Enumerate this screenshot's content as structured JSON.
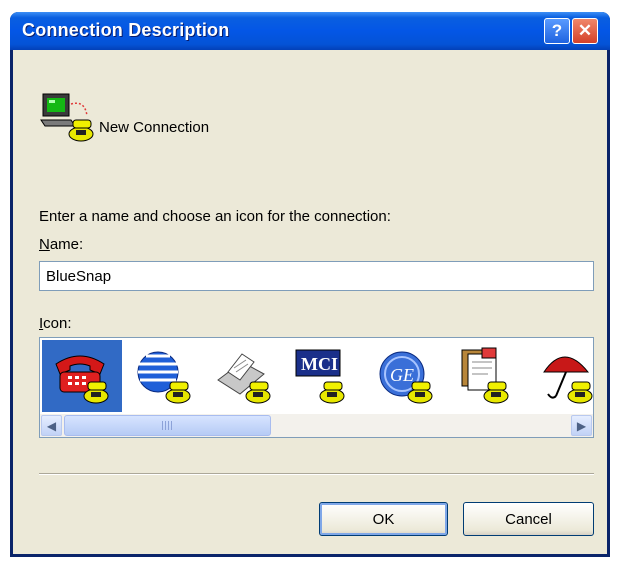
{
  "window": {
    "title": "Connection Description",
    "help_glyph": "?",
    "close_glyph": "✕"
  },
  "connection": {
    "name": "New Connection",
    "icon": "computer-phone-icon"
  },
  "prompt": "Enter a name and choose an icon for the connection:",
  "name_field": {
    "label_mnemonic": "N",
    "label_rest": "ame:",
    "value": "BlueSnap"
  },
  "icon_field": {
    "label_mnemonic": "I",
    "label_rest": "con:",
    "icons": [
      "red-phone-icon",
      "globe-phone-icon",
      "fax-phone-icon",
      "mci-phone-icon",
      "ge-phone-icon",
      "document-phone-icon",
      "umbrella-phone-icon"
    ],
    "selected_index": 0
  },
  "buttons": {
    "ok": "OK",
    "cancel": "Cancel"
  },
  "colors": {
    "title_bar": "#0456e6",
    "selection": "#316ac5",
    "dialog_bg": "#ece9d8"
  }
}
